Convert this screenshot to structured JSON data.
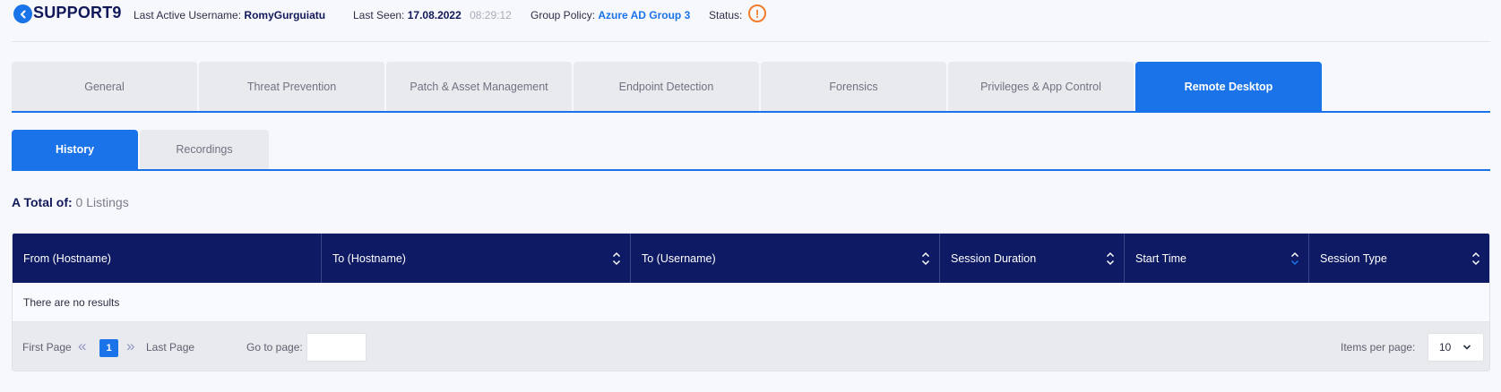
{
  "header": {
    "host_name": "SUPPORT9",
    "last_active_label": "Last Active Username:",
    "last_active_value": "RomyGurguiatu",
    "last_seen_label": "Last Seen:",
    "last_seen_date": "17.08.2022",
    "last_seen_time": "08:29:12",
    "group_policy_label": "Group Policy:",
    "group_policy_value": "Azure AD Group 3",
    "status_label": "Status:",
    "status_icon": "warning-icon",
    "status_glyph": "!",
    "status_color": "#f07d2c"
  },
  "main_tabs": [
    {
      "label": "General",
      "active": false
    },
    {
      "label": "Threat Prevention",
      "active": false
    },
    {
      "label": "Patch & Asset Management",
      "active": false
    },
    {
      "label": "Endpoint Detection",
      "active": false
    },
    {
      "label": "Forensics",
      "active": false
    },
    {
      "label": "Privileges & App Control",
      "active": false
    },
    {
      "label": "Remote Desktop",
      "active": true
    }
  ],
  "sub_tabs": [
    {
      "label": "History",
      "active": true
    },
    {
      "label": "Recordings",
      "active": false
    }
  ],
  "summary": {
    "total_label": "A Total of:",
    "total_count": "0 Listings"
  },
  "table": {
    "columns": [
      {
        "label": "From (Hostname)",
        "sortable": false
      },
      {
        "label": "To (Hostname)",
        "sortable": true
      },
      {
        "label": "To (Username)",
        "sortable": true
      },
      {
        "label": "Session Duration",
        "sortable": true
      },
      {
        "label": "Start Time",
        "sortable": true,
        "sorted": "desc"
      },
      {
        "label": "Session Type",
        "sortable": true
      }
    ],
    "empty_message": "There are no results"
  },
  "pagination": {
    "first_page_label": "First Page",
    "current_page": "1",
    "last_page_label": "Last Page",
    "goto_label": "Go to page:",
    "goto_value": "",
    "items_per_page_label": "Items per page:",
    "items_per_page_value": "10"
  },
  "colors": {
    "accent": "#1a73e8",
    "header_navy": "#0e1a64",
    "tab_inactive": "#e9eaee"
  }
}
